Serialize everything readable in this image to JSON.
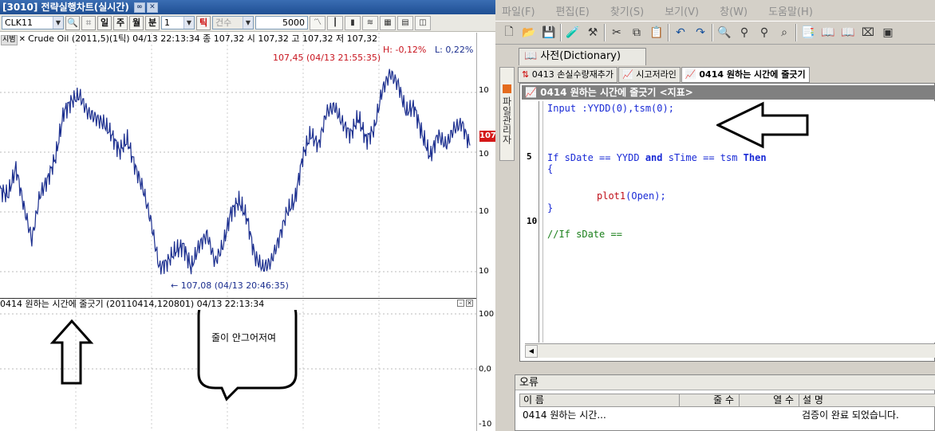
{
  "left_window": {
    "title": "[3010] 전략실행차트(실시간)",
    "toolbar": {
      "symbol": "CLK11",
      "period_labels": [
        "일",
        "주",
        "월",
        "분"
      ],
      "interval": "1",
      "tick_label": "틱",
      "unit": "건수",
      "count": "5000"
    },
    "info_tag": "시범",
    "info_line": "Crude Oil (2011,5)(1틱) 04/13 22:13:34  종 107,32  시 107,32 고 107,32 저 107,32",
    "hi_label": "H: -0,12%",
    "lo_label": "L: 0,22%",
    "high_annotation": "107,45 (04/13 21:55:35)",
    "low_annotation": "← 107,08 (04/13 20:46:35)",
    "price_badge": "107",
    "right_scale": [
      "10",
      "10",
      "10",
      "10",
      "100",
      "0,0",
      "-10"
    ],
    "indicator_header": "0414 원하는 시간에 줄긋기  (20110414,120801)  04/13 22:13:34",
    "bubble_text": "줄이 안그어저여",
    "colors": {
      "line": "#1c2f8f",
      "annotation_red": "#c8141e",
      "title_bg": "#2a5ea6"
    }
  },
  "chart_data": {
    "type": "line",
    "title": "Crude Oil (2011,5)(1틱)",
    "x": [
      0,
      10,
      20,
      30,
      40,
      50,
      60,
      70,
      80,
      90,
      100,
      110,
      120,
      130,
      140,
      150,
      160,
      170,
      180,
      190,
      200,
      210,
      220,
      230,
      240,
      250,
      260,
      270,
      280,
      290,
      300,
      310,
      320,
      330,
      340,
      350,
      360,
      370,
      380,
      390,
      400,
      410,
      420,
      430,
      440,
      450,
      460,
      470,
      480,
      490,
      500,
      510,
      520,
      530,
      540,
      550,
      560,
      570,
      580,
      590
    ],
    "values": [
      107.24,
      107.23,
      107.28,
      107.21,
      107.15,
      107.23,
      107.26,
      107.3,
      107.38,
      107.4,
      107.41,
      107.38,
      107.37,
      107.36,
      107.34,
      107.31,
      107.33,
      107.28,
      107.24,
      107.18,
      107.1,
      107.11,
      107.13,
      107.14,
      107.1,
      107.14,
      107.16,
      107.11,
      107.14,
      107.2,
      107.22,
      107.19,
      107.12,
      107.1,
      107.11,
      107.15,
      107.2,
      107.22,
      107.3,
      107.34,
      107.32,
      107.38,
      107.39,
      107.36,
      107.34,
      107.37,
      107.33,
      107.35,
      107.42,
      107.45,
      107.43,
      107.38,
      107.39,
      107.34,
      107.3,
      107.34,
      107.32,
      107.35,
      107.36,
      107.32
    ],
    "ylim": [
      107.05,
      107.5
    ],
    "indicator_scale": [
      "100",
      "0,0",
      "-10"
    ]
  },
  "right_window": {
    "menu": [
      "파일(F)",
      "편집(E)",
      "찾기(S)",
      "보기(V)",
      "창(W)",
      "도움말(H)"
    ],
    "dict_tab": "사전(Dictionary)",
    "sidebar_tab": "파일관리자",
    "doc_tabs": [
      "0413 손실수량재추가",
      "시고저라인",
      "0414 원하는 시간에 줄긋기"
    ],
    "editor_title": "0414 원하는 시간에 줄긋기 <지표>",
    "code": {
      "line1_kw": "Input",
      "line1_rest": " :YYDD(0),tsm(0);",
      "line5_a": "If",
      "line5_b": " sDate == YYDD ",
      "line5_c": "and",
      "line5_d": " sTime == tsm ",
      "line5_e": "Then",
      "brace_open": "{",
      "plot_fn": "plot1",
      "plot_arg": "(Open);",
      "brace_close": "}",
      "comment": "//If sDate =="
    },
    "line_numbers": [
      "5",
      "10"
    ],
    "error_panel": {
      "title": "오류",
      "headers": [
        "이 름",
        "줄 수",
        "열 수",
        "설 명"
      ],
      "row": {
        "name": "0414 원하는 시간...",
        "line": "",
        "col": "",
        "desc": "검증이 완료 되었습니다."
      }
    }
  }
}
